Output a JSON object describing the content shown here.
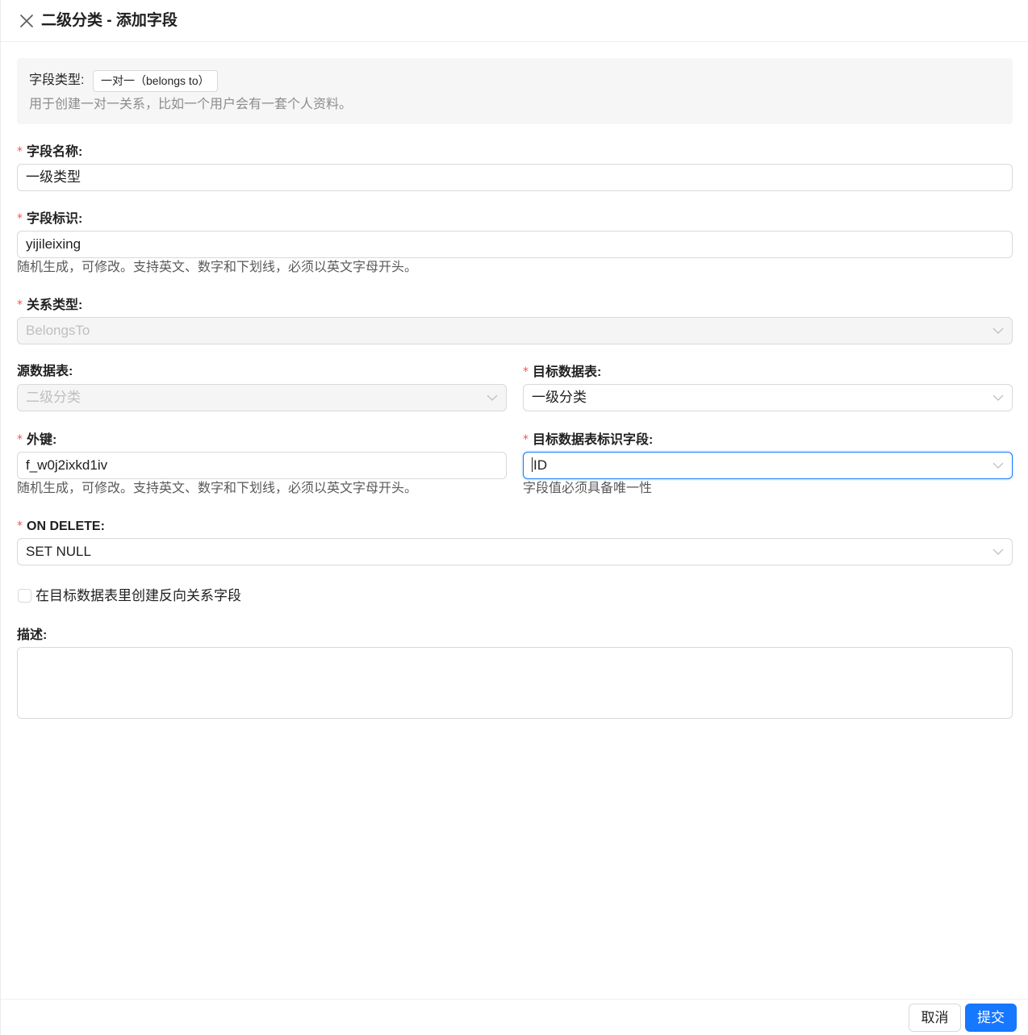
{
  "header": {
    "title": "二级分类 - 添加字段",
    "close_icon": "close-icon"
  },
  "info": {
    "type_label": "字段类型:",
    "type_tag": "一对一（belongs to）",
    "description": "用于创建一对一关系，比如一个用户会有一套个人资料。"
  },
  "form": {
    "required_mark": "*",
    "field_name": {
      "label": "字段名称:",
      "value": "一级类型"
    },
    "field_key": {
      "label": "字段标识:",
      "value": "yijileixing",
      "help": "随机生成，可修改。支持英文、数字和下划线，必须以英文字母开头。"
    },
    "relation_type": {
      "label": "关系类型:",
      "value": "BelongsTo",
      "disabled": true
    },
    "source_table": {
      "label": "源数据表:",
      "value": "二级分类",
      "disabled": true
    },
    "target_table": {
      "label": "目标数据表:",
      "value": "一级分类"
    },
    "foreign_key": {
      "label": "外键:",
      "value": "f_w0j2ixkd1iv",
      "help": "随机生成，可修改。支持英文、数字和下划线，必须以英文字母开头。"
    },
    "target_key": {
      "label": "目标数据表标识字段:",
      "value": "ID",
      "help": "字段值必须具备唯一性"
    },
    "on_delete": {
      "label": "ON DELETE:",
      "value": "SET NULL"
    },
    "reverse_field": {
      "label": "在目标数据表里创建反向关系字段",
      "checked": false
    },
    "description": {
      "label": "描述:",
      "value": ""
    }
  },
  "footer": {
    "cancel_label": "取消",
    "submit_label": "提交"
  },
  "colors": {
    "primary": "#1677ff",
    "required": "#ff4d4f",
    "border": "#d9d9d9",
    "disabled_bg": "#f5f5f5"
  }
}
